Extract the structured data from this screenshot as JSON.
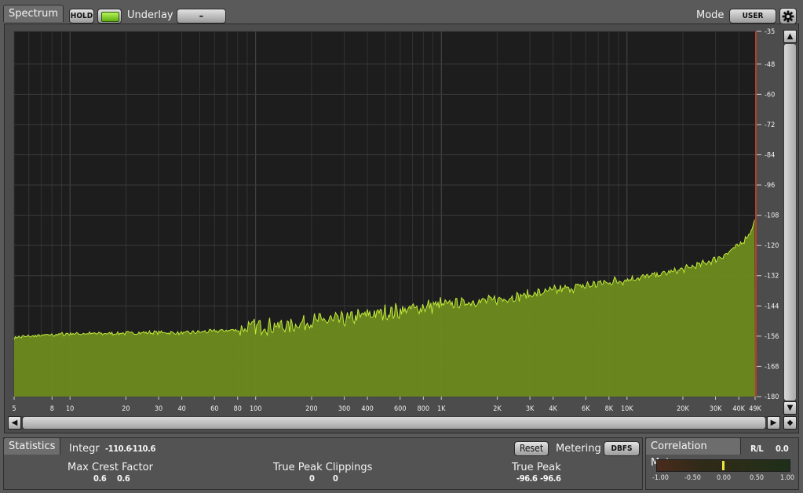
{
  "header": {
    "spectrum_tab": "Spectrum",
    "hold_label": "HOLD",
    "underlay_label": "Underlay",
    "underlay_value": "–",
    "mode_label": "Mode",
    "mode_value": "USER",
    "settings_icon": "gear-icon"
  },
  "colors": {
    "spectrum_fill": "#6e8b1f",
    "spectrum_line": "#c2ea3a",
    "plot_bg": "#1d1d1d",
    "hold_indicator": "#7ed321",
    "limit_line": "#d43b2a"
  },
  "chart_data": {
    "type": "area",
    "x_scale": "log",
    "x_tick_labels": [
      "5",
      "8",
      "10",
      "20",
      "30",
      "40",
      "60",
      "80",
      "100",
      "200",
      "300",
      "400",
      "600",
      "800",
      "1K",
      "2K",
      "3K",
      "4K",
      "6K",
      "8K",
      "10K",
      "20K",
      "30K",
      "40K",
      "49K"
    ],
    "x_tick_values": [
      5,
      8,
      10,
      20,
      30,
      40,
      60,
      80,
      100,
      200,
      300,
      400,
      600,
      800,
      1000,
      2000,
      3000,
      4000,
      6000,
      8000,
      10000,
      20000,
      30000,
      40000,
      49000
    ],
    "y_tick_labels": [
      "-35",
      "-48",
      "-60",
      "-72",
      "-84",
      "-96",
      "-108",
      "-120",
      "-132",
      "-144",
      "-156",
      "-168",
      "-180"
    ],
    "xlim": [
      5,
      49000
    ],
    "ylim": [
      -180,
      -35
    ],
    "grid": true,
    "series": [
      {
        "x": [
          5,
          8,
          10,
          15,
          20,
          30,
          40,
          60,
          80,
          100,
          150,
          200,
          300,
          400,
          600,
          800,
          1000,
          2000,
          3000,
          4000,
          6000,
          8000,
          10000,
          15000,
          20000,
          25000,
          30000,
          35000,
          40000,
          45000,
          48000,
          49000
        ],
        "y": [
          -156.5,
          -155.5,
          -155,
          -155,
          -154.8,
          -154.5,
          -154.8,
          -154,
          -153.5,
          -152,
          -152,
          -150,
          -149.5,
          -147.5,
          -146,
          -144.5,
          -143.5,
          -141.5,
          -139.5,
          -138,
          -136,
          -134.5,
          -133.5,
          -131.5,
          -129.5,
          -127.5,
          -125.5,
          -123,
          -120,
          -116,
          -112,
          -108
        ]
      }
    ]
  },
  "scroll": {
    "left_icon": "arrow-left-icon",
    "right_icon": "arrow-right-icon",
    "up_icon": "arrow-up-icon",
    "down_icon": "arrow-down-icon",
    "reset_icon": "diamond-icon"
  },
  "statistics": {
    "tab": "Statistics",
    "integr_label": "Integr",
    "integr_l": "-110.6",
    "integr_r": "-110.6",
    "reset_label": "Reset",
    "metering_label": "Metering",
    "metering_value": "DBFS",
    "max_crest_label": "Max Crest Factor",
    "max_crest_l": "0.6",
    "max_crest_r": "0.6",
    "clip_label": "True Peak Clippings",
    "clip_l": "0",
    "clip_r": "0",
    "true_peak_label": "True Peak",
    "true_peak_l": "-96.6",
    "true_peak_r": "-96.6"
  },
  "correlation": {
    "tab": "Correlation Meter",
    "rl_label": "R/L",
    "rl_value": "0.0",
    "value": 0.0,
    "scale": [
      "-1.00",
      "-0.50",
      "0.00",
      "0.50",
      "1.00"
    ]
  }
}
